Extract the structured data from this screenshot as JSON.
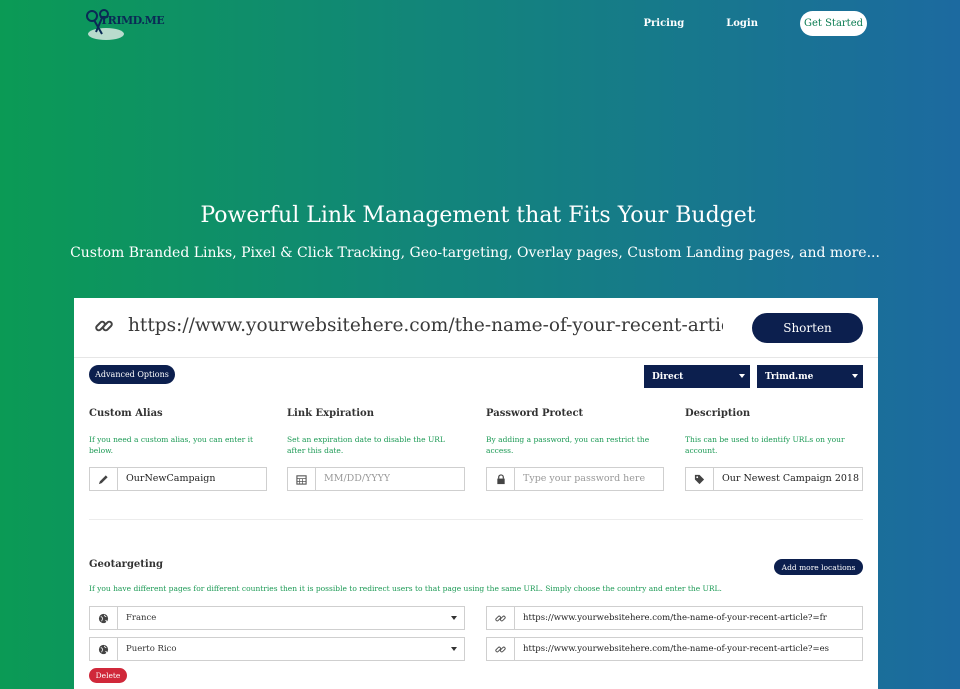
{
  "header": {
    "logo_text": "TRIMD.ME",
    "nav": {
      "pricing": "Pricing",
      "login": "Login",
      "get_started": "Get Started"
    }
  },
  "hero": {
    "title": "Powerful Link Management that Fits Your Budget",
    "subtitle": "Custom Branded Links, Pixel & Click Tracking, Geo-targeting, Overlay pages, Custom Landing pages, and more..."
  },
  "shortener": {
    "url_value": "https://www.yourwebsitehere.com/the-name-of-your-recent-article",
    "shorten_label": "Shorten",
    "advanced_label": "Advanced Options",
    "redirect_type": "Direct",
    "domain": "Trimd.me"
  },
  "fields": {
    "alias": {
      "label": "Custom Alias",
      "help": "If you need a custom alias, you can enter it below.",
      "value": "OurNewCampaign"
    },
    "expiration": {
      "label": "Link Expiration",
      "help": "Set an expiration date to disable the URL after this date.",
      "placeholder": "MM/DD/YYYY"
    },
    "password": {
      "label": "Password Protect",
      "help": "By adding a password, you can restrict the access.",
      "placeholder": "Type your password here"
    },
    "description": {
      "label": "Description",
      "help": "This can be used to identify URLs on your account.",
      "value": "Our Newest Campaign 2018"
    }
  },
  "geo": {
    "title": "Geotargeting",
    "add_label": "Add more locations",
    "help": "If you have different pages for different countries then it is possible to redirect users to that page using the same URL. Simply choose the country and enter the URL.",
    "rows": [
      {
        "country": "France",
        "url": "https://www.yourwebsitehere.com/the-name-of-your-recent-article?=fr"
      },
      {
        "country": "Puerto Rico",
        "url": "https://www.yourwebsitehere.com/the-name-of-your-recent-article?=es"
      }
    ],
    "delete_label": "Delete"
  }
}
